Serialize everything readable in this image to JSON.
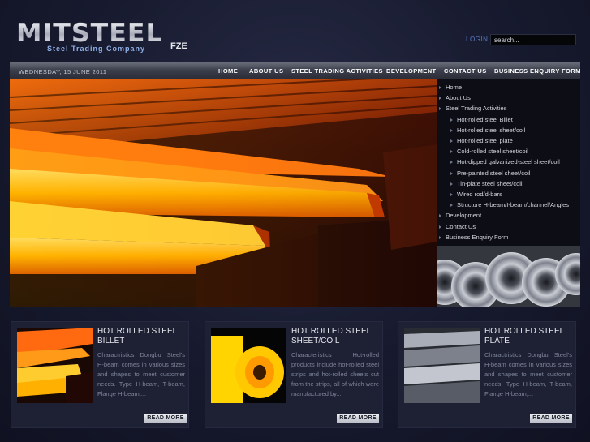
{
  "header": {
    "logo": {
      "name": "MITSTEEL",
      "tagline": "Steel Trading Company",
      "suffix": "FZE"
    },
    "login_label": "LOGIN",
    "search_placeholder": "search..."
  },
  "navbar": {
    "date": "WEDNESDAY, 15 JUNE 2011",
    "items": [
      {
        "label": "HOME"
      },
      {
        "label": "ABOUT US"
      },
      {
        "label": "STEEL TRADING ACTIVITIES"
      },
      {
        "label": "DEVELOPMENT"
      },
      {
        "label": "CONTACT US"
      },
      {
        "label": "BUSINESS ENQUIRY FORM"
      }
    ]
  },
  "side_menu": {
    "items": [
      {
        "label": "Home",
        "level": 1
      },
      {
        "label": "About Us",
        "level": 1
      },
      {
        "label": "Steel Trading Activities",
        "level": 1
      },
      {
        "label": "Hot-rolled steel Billet",
        "level": 2
      },
      {
        "label": "Hot-rolled steel sheet/coil",
        "level": 2
      },
      {
        "label": "Hot-rolled steel plate",
        "level": 2
      },
      {
        "label": "Cold-rolled steel sheet/coil",
        "level": 2
      },
      {
        "label": "Hot-dipped galvanized-steel sheet/coil",
        "level": 2
      },
      {
        "label": "Pre-painted steel sheet/coil",
        "level": 2
      },
      {
        "label": "Tin-plate steel sheet/coil",
        "level": 2
      },
      {
        "label": "Wired rod/d-bars",
        "level": 2
      },
      {
        "label": "Structure H-beam/I-beam/channel/Angles",
        "level": 2
      },
      {
        "label": "Development",
        "level": 1
      },
      {
        "label": "Contact Us",
        "level": 1
      },
      {
        "label": "Business Enquiry Form",
        "level": 1
      }
    ]
  },
  "cards": [
    {
      "title": "HOT ROLLED STEEL BILLET",
      "text": "Charactristics Dongbu Steel's H-beam comes in various sizes and shapes to meet customer needs. Type H-beam, T-beam, Flange H-beam,...",
      "button": "READ MORE"
    },
    {
      "title": "HOT ROLLED STEEL SHEET/COIL",
      "text": "Characteristics Hot-rolled products include hot-rolled steel strips and hot-rolled sheets cut from the strips, all of which were manufactured by...",
      "button": "READ MORE"
    },
    {
      "title": "HOT ROLLED STEEL PLATE",
      "text": "Charactristics Dongbu Steel's H-beam comes in various sizes and shapes to meet customer needs. Type H-beam, T-beam, Flange H-beam,...",
      "button": "READ MORE"
    }
  ],
  "colors": {
    "background": "#15172a",
    "navbar": "#3b3e4b",
    "card": "#1e2134",
    "accent_link": "#5a7cc4"
  }
}
